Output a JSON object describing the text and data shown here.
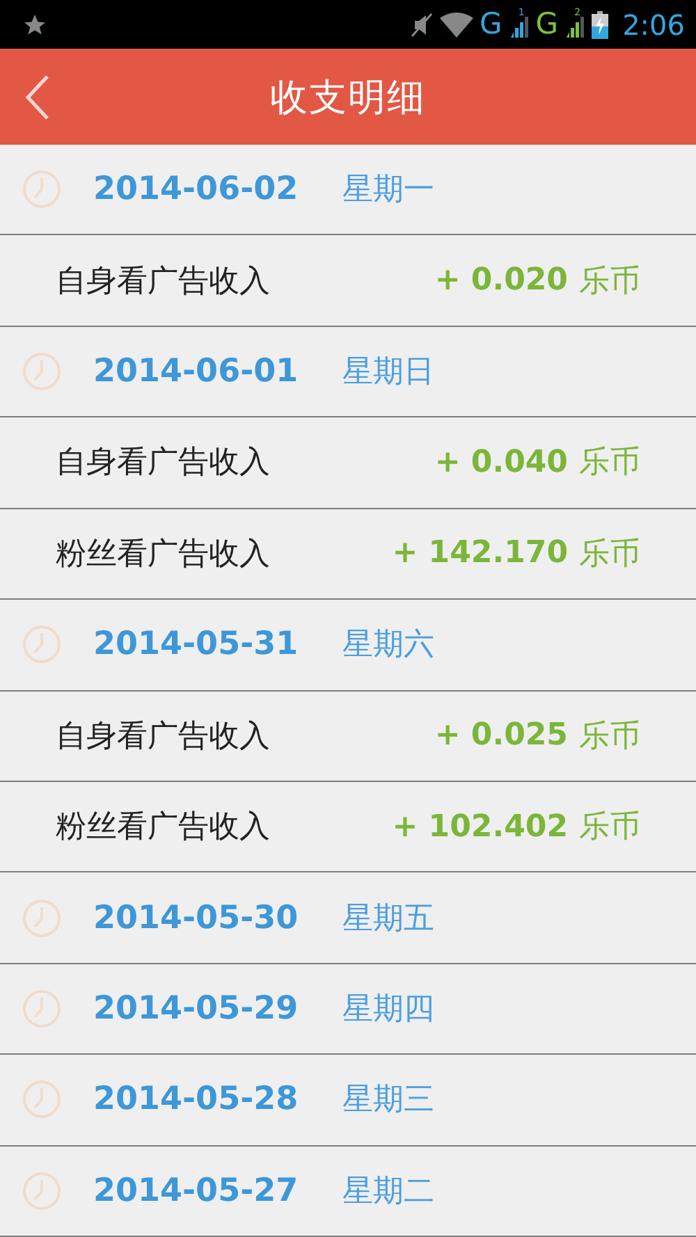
{
  "status_bar": {
    "signals": [
      {
        "network": "G",
        "sim": "1",
        "color": "#33a6df"
      },
      {
        "network": "G",
        "sim": "2",
        "color": "#7ec13a"
      }
    ],
    "time": "2:06"
  },
  "header": {
    "title": "收支明细"
  },
  "rows": [
    {
      "kind": "date",
      "date": "2014-06-02",
      "weekday": "星期一"
    },
    {
      "kind": "entry",
      "label": "自身看广告收入",
      "amount": "+ 0.020",
      "unit": "乐币"
    },
    {
      "kind": "date",
      "date": "2014-06-01",
      "weekday": "星期日"
    },
    {
      "kind": "entry",
      "label": "自身看广告收入",
      "amount": "+ 0.040",
      "unit": "乐币"
    },
    {
      "kind": "entry",
      "label": "粉丝看广告收入",
      "amount": "+ 142.170",
      "unit": "乐币"
    },
    {
      "kind": "date",
      "date": "2014-05-31",
      "weekday": "星期六"
    },
    {
      "kind": "entry",
      "label": "自身看广告收入",
      "amount": "+ 0.025",
      "unit": "乐币"
    },
    {
      "kind": "entry",
      "label": "粉丝看广告收入",
      "amount": "+ 102.402",
      "unit": "乐币"
    },
    {
      "kind": "date",
      "date": "2014-05-30",
      "weekday": "星期五"
    },
    {
      "kind": "date",
      "date": "2014-05-29",
      "weekday": "星期四"
    },
    {
      "kind": "date",
      "date": "2014-05-28",
      "weekday": "星期三"
    },
    {
      "kind": "date",
      "date": "2014-05-27",
      "weekday": "星期二"
    }
  ]
}
